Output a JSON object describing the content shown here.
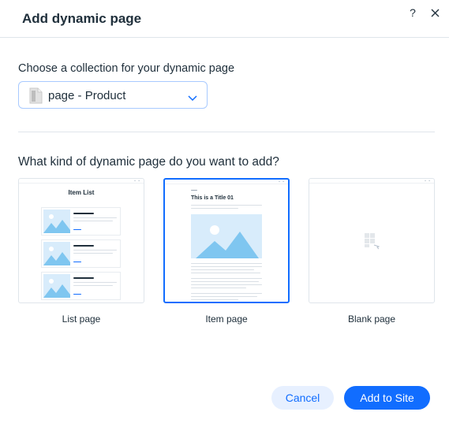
{
  "dialog": {
    "title": "Add dynamic page",
    "help_label": "?",
    "close_label": "✕"
  },
  "collection": {
    "label": "Choose a collection for your dynamic page",
    "selected_value": "page - Product",
    "icon": "document-icon"
  },
  "page_type": {
    "label": "What kind of dynamic page do you want to add?",
    "options": [
      {
        "label": "List page",
        "thumbnail_title": "Item List",
        "selected": false
      },
      {
        "label": "Item page",
        "thumbnail_title": "This is a Title 01",
        "selected": true
      },
      {
        "label": "Blank page",
        "thumbnail_title": "",
        "selected": false
      }
    ]
  },
  "footer": {
    "cancel_label": "Cancel",
    "add_label": "Add to Site"
  },
  "colors": {
    "primary": "#116dff",
    "primary_light": "#e7f0ff",
    "text": "#20303c",
    "image_placeholder": "#d8ecfb",
    "image_shape": "#7fc6f0"
  }
}
